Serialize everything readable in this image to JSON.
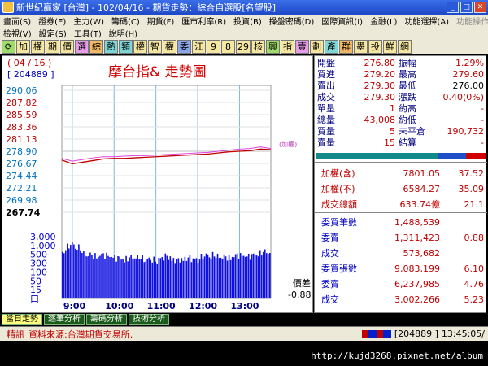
{
  "window": {
    "title": "新世紀贏家 [台灣]  - 102/04/16 - 期貨走勢：綜合自選股[名望股]"
  },
  "menu": {
    "row1": [
      "畫面(S)",
      "證券(E)",
      "主力(W)",
      "籌碼(C)",
      "期貨(F)",
      "匯市利率(R)",
      "投資(B)",
      "操盤密碼(D)",
      "國際資訊(I)",
      "金融(L)",
      "功能選擇(A)",
      "功能操作(K)"
    ],
    "row2": [
      "檢視(V)",
      "設定(S)",
      "工具(T)",
      "說明(H)"
    ]
  },
  "toolbar": {
    "buttons": [
      "⟳",
      "加",
      "權",
      "期",
      "價",
      "選",
      "綜",
      "熱",
      "類",
      "權",
      "智",
      "權",
      "委",
      "江",
      "9",
      "8",
      "29",
      "核",
      "興",
      "指",
      "壹",
      "劃",
      "產",
      "群",
      "墨",
      "投",
      "鮮",
      "網"
    ]
  },
  "chart": {
    "date": "( 04 / 16 )",
    "code": "[ 204889 ]",
    "title": "摩台指&  走勢圖",
    "ref_label": "(加權)",
    "price_ticks": [
      "290.06",
      "287.82",
      "285.59",
      "283.36",
      "281.13",
      "278.90",
      "276.67",
      "274.44",
      "272.21",
      "269.98",
      "267.74"
    ],
    "volume_ticks": [
      "3,000",
      "1,000",
      "500",
      "300",
      "100",
      "50",
      "15",
      "口"
    ],
    "time_ticks": [
      "9:00",
      "10:00",
      "11:00",
      "12:00",
      "13:00"
    ],
    "diff_label": "價差",
    "diff_value": "-0.88"
  },
  "chart_data": {
    "type": "line",
    "title": "摩台指&  走勢圖",
    "ylim": [
      267.74,
      290.06
    ],
    "x": [
      "8:45",
      "9:00",
      "9:15",
      "9:30",
      "9:45",
      "10:00",
      "10:15",
      "10:30",
      "10:45",
      "11:00",
      "11:15",
      "11:30",
      "11:45",
      "12:00",
      "12:15",
      "12:30",
      "12:45",
      "13:00",
      "13:15",
      "13:30",
      "13:45"
    ],
    "series": [
      {
        "name": "",
        "color": "#c00000",
        "values": [
          277.3,
          276.6,
          276.9,
          277.2,
          277.5,
          277.6,
          277.6,
          277.7,
          277.8,
          277.9,
          278.0,
          278.1,
          278.2,
          278.3,
          278.4,
          278.6,
          278.8,
          278.9,
          279.0,
          279.3,
          279.2
        ]
      },
      {
        "name": "(加權)",
        "color": "#e040e0",
        "values": [
          277.6,
          277.1,
          277.4,
          277.7,
          277.9,
          277.9,
          278.0,
          278.1,
          278.1,
          278.2,
          278.3,
          278.4,
          278.5,
          278.6,
          278.7,
          278.9,
          279.1,
          279.3,
          279.4,
          279.7,
          279.4
        ]
      }
    ],
    "volume_ylim": [
      0,
      3000
    ],
    "volume": [
      420,
      1350,
      380,
      260,
      310,
      220,
      180,
      240,
      190,
      150,
      260,
      140,
      210,
      170,
      320,
      260,
      220,
      300,
      250,
      380,
      520
    ]
  },
  "quote": {
    "rows": [
      {
        "l1": "開盤",
        "v1": "276.80",
        "l2": "振幅",
        "v2": "1.29%"
      },
      {
        "l1": "買進",
        "v1": "279.20",
        "l2": "最高",
        "v2": "279.60"
      },
      {
        "l1": "賣出",
        "v1": "279.30",
        "l2": "最低",
        "v2": "276.00"
      },
      {
        "l1": "成交",
        "v1": "279.30",
        "l2": "漲跌",
        "v2": "0.40(0%)"
      },
      {
        "l1": "單量",
        "v1": "1",
        "l2": "約高",
        "v2": "-"
      },
      {
        "l1": "總量",
        "v1": "43,008",
        "l2": "約低",
        "v2": "-"
      },
      {
        "l1": "買量",
        "v1": "5",
        "l2": "未平倉",
        "v2": "190,732"
      },
      {
        "l1": "賣量",
        "v1": "15",
        "l2": "結算",
        "v2": "-"
      }
    ],
    "index_rows": [
      {
        "label": "加權(含)",
        "value": "7801.05",
        "extra": "37.52"
      },
      {
        "label": "加權(不)",
        "value": "6584.27",
        "extra": "35.09"
      },
      {
        "label": "成交總額",
        "value": "633.74億",
        "extra": "21.1"
      }
    ],
    "order_rows": [
      {
        "label": "委買筆數",
        "value": "1,488,539",
        "extra": ""
      },
      {
        "label": "委賣",
        "value": "1,311,423",
        "extra": "0.88"
      },
      {
        "label": "成交",
        "value": "573,682",
        "extra": ""
      },
      {
        "label": "委買張數",
        "value": "9,083,199",
        "extra": "6.10"
      },
      {
        "label": "委賣",
        "value": "6,237,985",
        "extra": "4.76"
      },
      {
        "label": "成交",
        "value": "3,002,266",
        "extra": "5.23"
      }
    ]
  },
  "tabs": [
    "當日走勢",
    "逐筆分析",
    "籌碼分析",
    "技術分析"
  ],
  "status": {
    "left": "精訊",
    "source": "資料來源:台灣期貨交易所.",
    "code": "[204889 ]",
    "time": "13:45:05/"
  },
  "footer": {
    "url": "http://kujd3268.pixnet.net/album"
  }
}
